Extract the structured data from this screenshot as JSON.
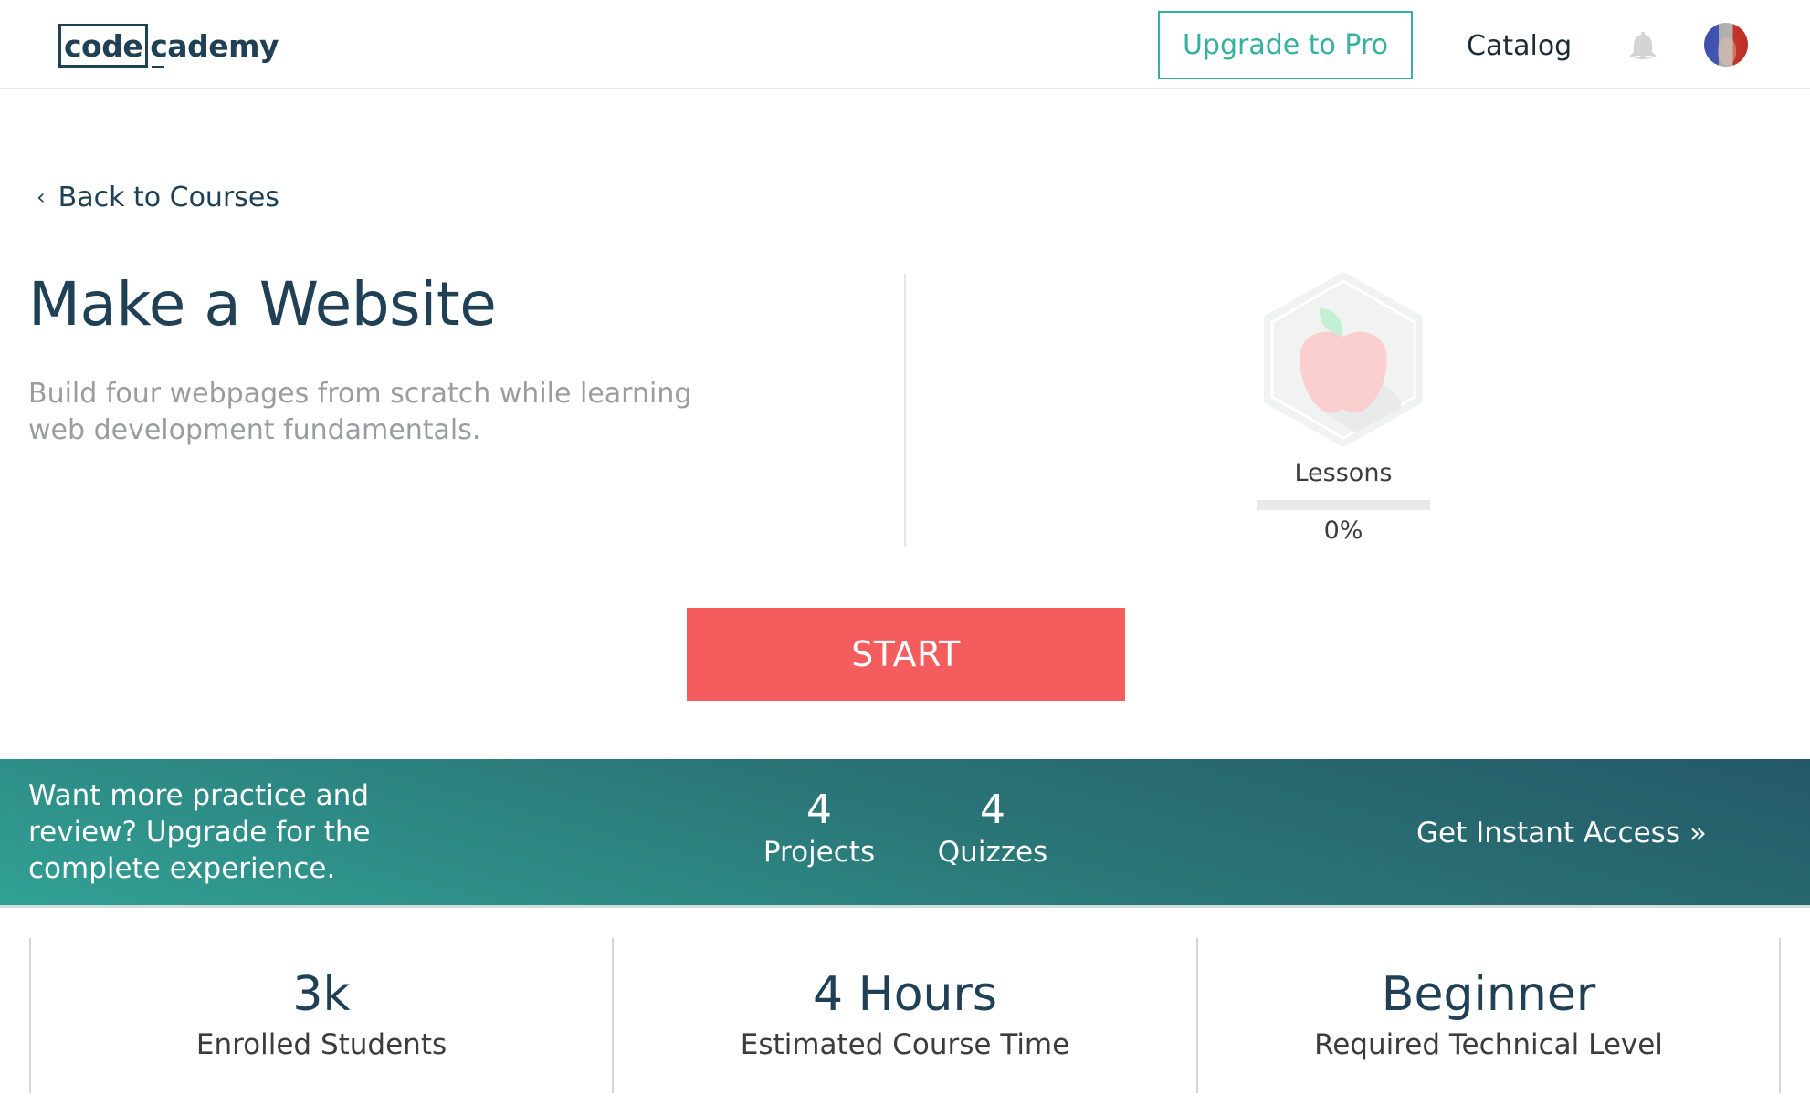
{
  "header": {
    "logo": {
      "boxed": "code",
      "rest": "cademy"
    },
    "upgrade_label": "Upgrade to Pro",
    "catalog_label": "Catalog",
    "icons": {
      "notifications": "bell-icon",
      "avatar": "user-avatar"
    }
  },
  "nav": {
    "back_label": "Back to Courses",
    "back_icon": "‹"
  },
  "course": {
    "title": "Make a Website",
    "description": "Build four webpages from scratch while learning web development fundamentals.",
    "badge_icon": "apple-icon",
    "progress_label": "Lessons",
    "progress_percent": 0,
    "progress_text": "0%",
    "start_label": "START"
  },
  "colors": {
    "brand": "#204056",
    "accent": "#37b19f",
    "start": "#f55c5d"
  },
  "banner": {
    "message": "Want more practice and review? Upgrade for the complete experience.",
    "stats": [
      {
        "value": "4",
        "label": "Projects"
      },
      {
        "value": "4",
        "label": "Quizzes"
      }
    ],
    "cta_label": "Get Instant Access »"
  },
  "info": [
    {
      "value": "3k",
      "label": "Enrolled Students"
    },
    {
      "value": "4 Hours",
      "label": "Estimated Course Time"
    },
    {
      "value": "Beginner",
      "label": "Required Technical Level"
    }
  ]
}
